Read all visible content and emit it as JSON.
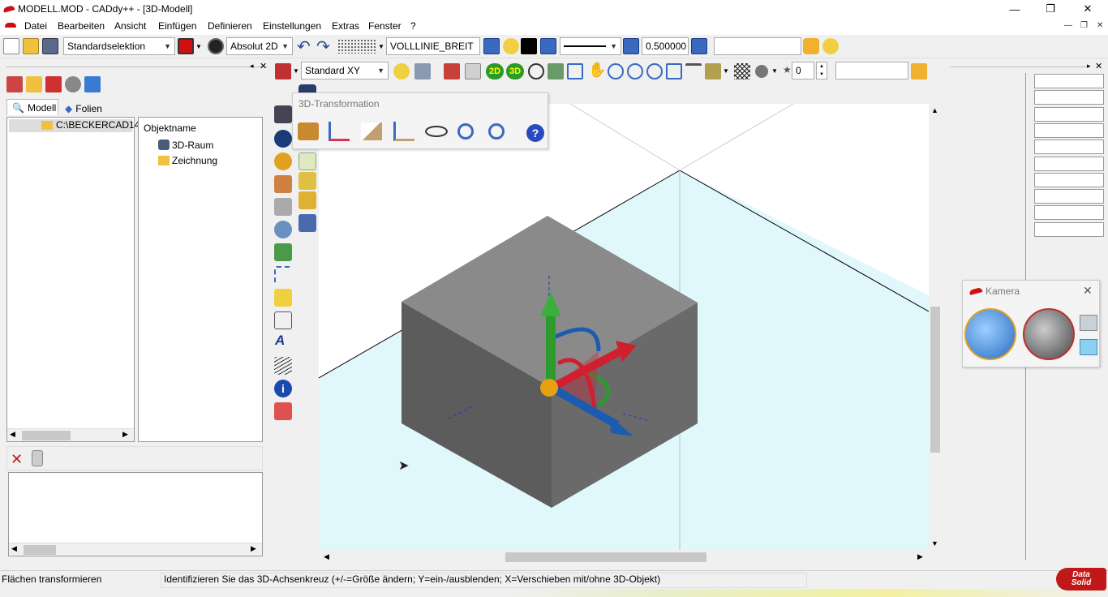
{
  "window": {
    "title": "MODELL.MOD - CADdy++ - [3D-Modell]",
    "controls": {
      "minimize": "—",
      "restore": "❐",
      "close": "✕"
    }
  },
  "menu": {
    "items": [
      "Datei",
      "Bearbeiten",
      "Ansicht",
      "Einfügen",
      "Definieren",
      "Einstellungen",
      "Extras",
      "Fenster",
      "?"
    ],
    "mdi": {
      "minimize": "—",
      "restore": "❐",
      "close": "✕"
    }
  },
  "toolbar": {
    "selection_mode": "Standardselektion",
    "coord_mode": "Absolut 2D",
    "layer": "VOLLLINIE_BREIT",
    "line_width": "0.500000",
    "free_field": ""
  },
  "view_toolbar": {
    "view": "Standard XY",
    "btn_2d": "2D",
    "btn_3d": "3D",
    "counter": "0",
    "field": ""
  },
  "left_panel": {
    "tabs": [
      "Modell",
      "Folien"
    ],
    "path": "C:\\BECKERCAD14",
    "object_header": "Objektname",
    "objects": [
      "3D-Raum",
      "Zeichnung"
    ]
  },
  "transform_popup": {
    "title": "3D-Transformation",
    "help": "?"
  },
  "kamera": {
    "title": "Kamera"
  },
  "status": {
    "left": "Flächen transformieren",
    "message": "Identifizieren Sie das 3D-Achsenkreuz (+/-=Größe ändern; Y=ein-/ausblenden; X=Verschieben mit/ohne 3D-Objekt)"
  },
  "brand": {
    "line1": "Data",
    "line2": "Solid"
  },
  "colors": {
    "accent_red": "#d01010",
    "floor": "#e0f8fc",
    "cube_top": "#8a8a8a",
    "cube_left": "#5c5c5c",
    "cube_right": "#6a6a6a",
    "axis_x": "#d02030",
    "axis_y": "#1a5cb0",
    "axis_z": "#2e9a2e"
  }
}
